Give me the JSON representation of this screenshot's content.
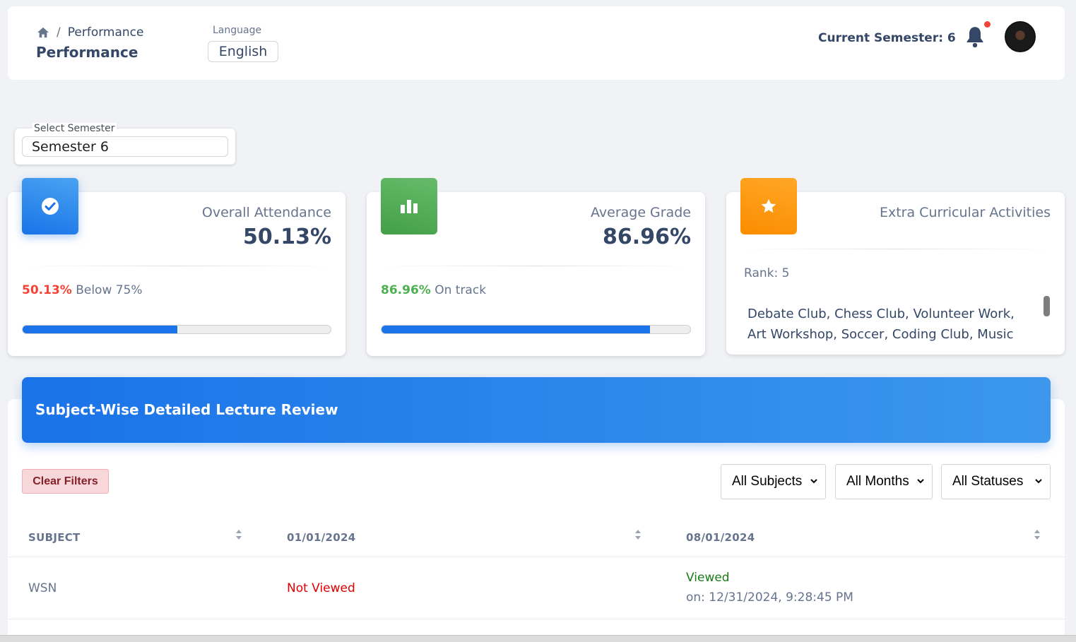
{
  "header": {
    "breadcrumb_current": "Performance",
    "breadcrumb_sep": "/",
    "page_title": "Performance",
    "language_label": "Language",
    "language_value": "English",
    "current_semester": "Current Semester: 6",
    "has_notification": true
  },
  "semester_select": {
    "label": "Select Semester",
    "value": "Semester 6"
  },
  "cards": {
    "attendance": {
      "title": "Overall Attendance",
      "value": "50.13%",
      "note_pct": "50.13%",
      "note_text": " Below 75%",
      "progress": 0.5013,
      "accent": "#f44335",
      "icon": "check-circle-icon",
      "icon_color": "#1a73e8"
    },
    "grade": {
      "title": "Average Grade",
      "value": "86.96%",
      "note_pct": "86.96%",
      "note_text": " On track",
      "progress": 0.8696,
      "accent": "#4caf50",
      "icon": "bar-chart-icon",
      "icon_color": "#4caf50"
    },
    "extra": {
      "title": "Extra Curricular Activities",
      "rank": "Rank: 5",
      "activities": "Debate Club, Chess Club, Volunteer Work, Art Workshop, Soccer, Coding Club, Music Band,",
      "icon": "star-icon",
      "icon_color": "#fb8c00"
    }
  },
  "lecture_review": {
    "title": "Subject-Wise Detailed Lecture Review",
    "clear_filters": "Clear Filters",
    "filters": {
      "subjects": "All Subjects",
      "months": "All Months",
      "statuses": "All Statuses"
    },
    "columns": [
      "SUBJECT",
      "01/01/2024",
      "08/01/2024"
    ],
    "rows": [
      {
        "subject": "WSN",
        "col1_status": "Not Viewed",
        "col2_status": "Viewed",
        "col2_time": "on: 12/31/2024, 9:28:45 PM"
      }
    ]
  },
  "colors": {
    "primary": "#1a73e8",
    "danger_text": "#e00000",
    "success_text": "#1a7d1a"
  }
}
